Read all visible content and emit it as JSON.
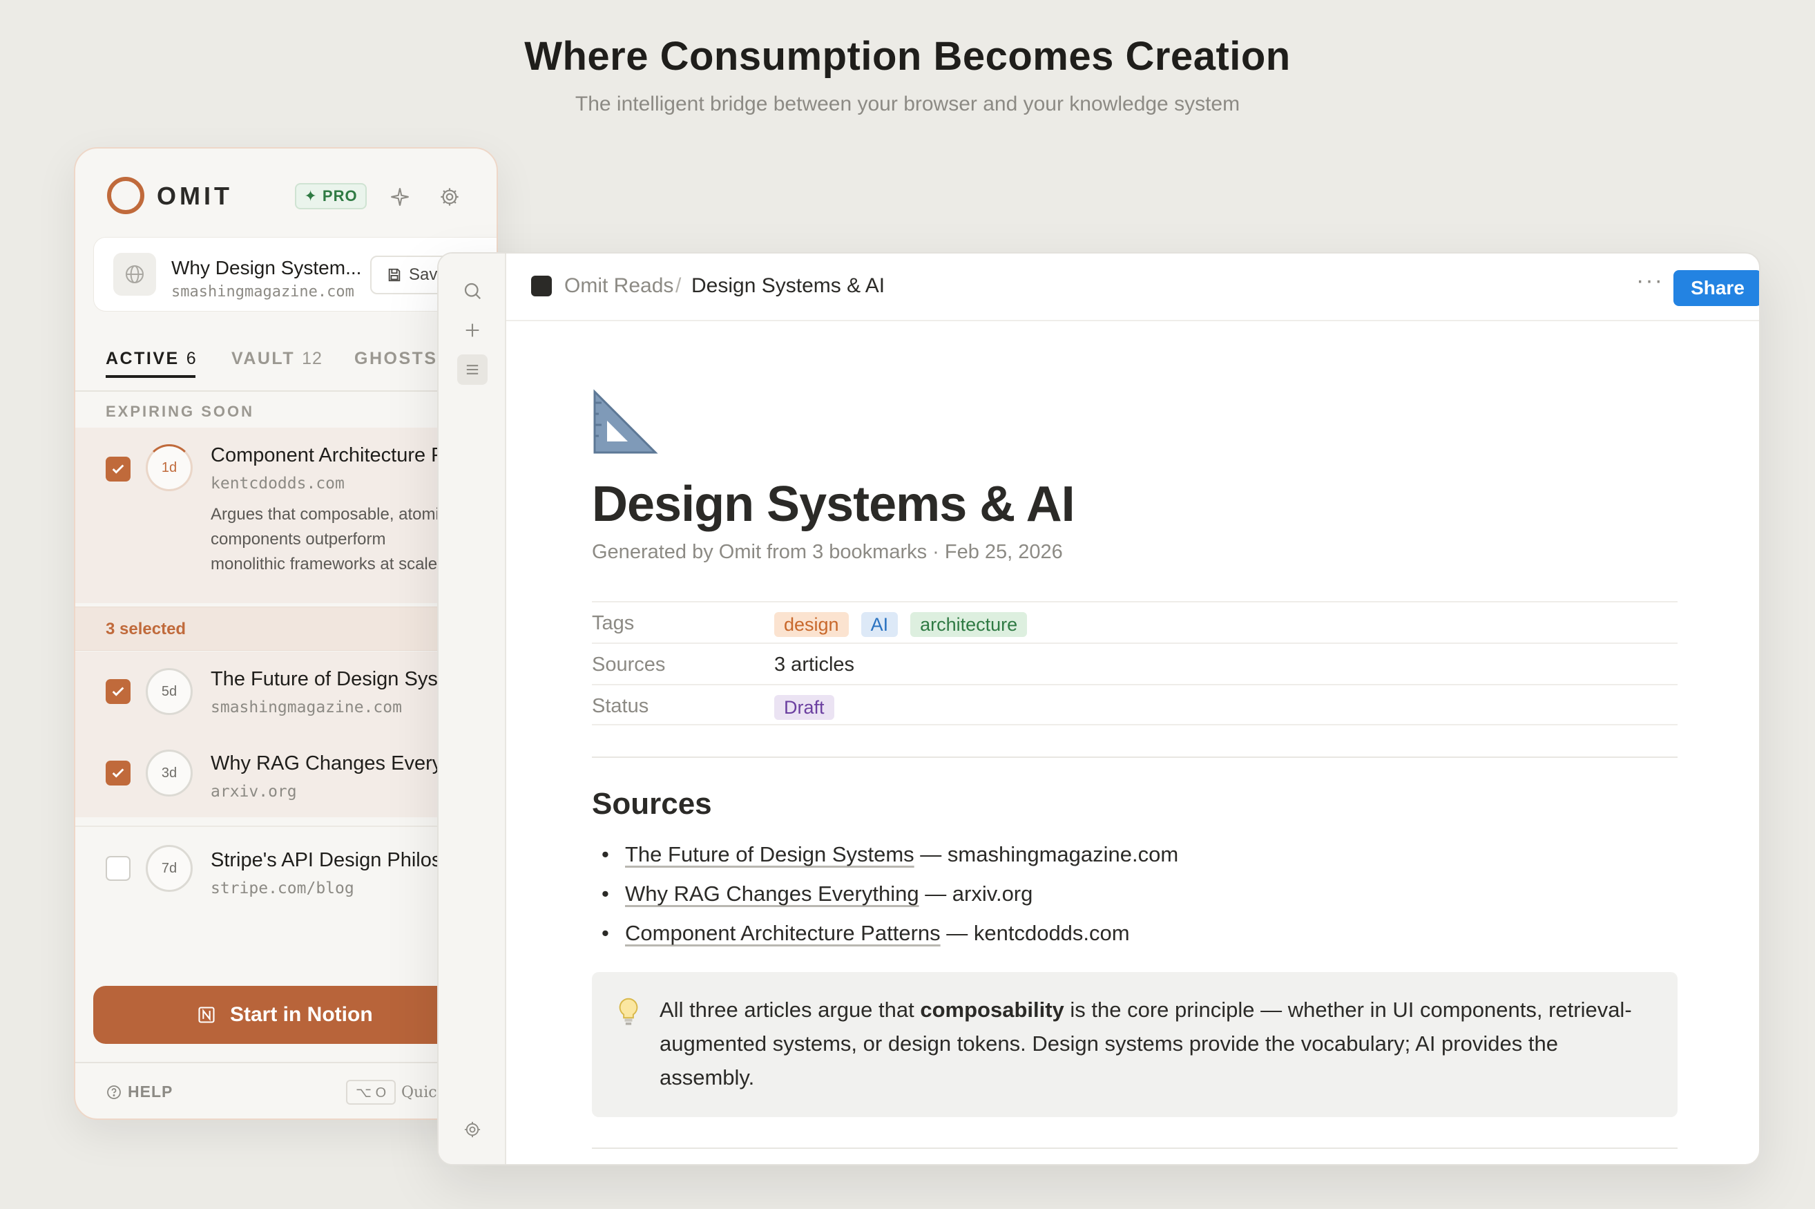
{
  "hero": {
    "title": "Where Consumption Becomes Creation",
    "subtitle": "The intelligent bridge between your browser and your knowledge system"
  },
  "extension": {
    "brand": "OMIT",
    "pro_badge": "✦ PRO",
    "current_page": {
      "title": "Why Design System...",
      "url": "smashingmagazine.com",
      "save_label": "Save"
    },
    "tabs": [
      {
        "label": "ACTIVE",
        "count": "6"
      },
      {
        "label": "VAULT",
        "count": "12"
      },
      {
        "label": "GHOSTS",
        "count": ""
      }
    ],
    "section_label": "EXPIRING SOON",
    "items": [
      {
        "days": "1d",
        "title": "Component Architecture Patterns",
        "url": "kentcdodds.com",
        "desc1": "Argues that composable, atomic",
        "desc2": "components outperform",
        "desc3": "monolithic frameworks at scale",
        "checked": true
      },
      {
        "days": "5d",
        "title": "The Future of Design Systems",
        "url": "smashingmagazine.com",
        "checked": true
      },
      {
        "days": "3d",
        "title": "Why RAG Changes Everything",
        "url": "arxiv.org",
        "checked": true
      },
      {
        "days": "7d",
        "title": "Stripe's API Design Philosophy",
        "url": "stripe.com/blog",
        "checked": false
      }
    ],
    "selected_text": "3 selected",
    "start_button": "Start in Notion",
    "help_label": "HELP",
    "shortcut_key": "⌥ O",
    "quick_label": "Quick"
  },
  "notion": {
    "breadcrumb_parent": "Omit Reads",
    "breadcrumb_sep": "/",
    "breadcrumb_current": "Design Systems & AI",
    "more_label": "···",
    "share_label": "Share",
    "doc": {
      "title": "Design Systems & AI",
      "meta": "Generated by Omit from 3 bookmarks · Feb 25, 2026",
      "props": {
        "tags_key": "Tags",
        "tags": [
          "design",
          "AI",
          "architecture"
        ],
        "sources_key": "Sources",
        "sources_val": "3 articles",
        "status_key": "Status",
        "status_val": "Draft"
      },
      "sources_heading": "Sources",
      "sources": [
        {
          "title": "The Future of Design Systems",
          "domain": " — smashingmagazine.com"
        },
        {
          "title": "Why RAG Changes Everything",
          "domain": " — arxiv.org"
        },
        {
          "title": "Component Architecture Patterns",
          "domain": " — kentcdodds.com"
        }
      ],
      "callout": {
        "pre": "All three articles argue that ",
        "bold": "composability",
        "post": " is the core principle — whether in UI components, retrieval-augmented systems, or design tokens. Design systems provide the vocabulary; AI provides the assembly."
      }
    }
  },
  "colors": {
    "accent": "#c06a3b",
    "share_blue": "#2383e2",
    "tag_design_bg": "#fbe3d0",
    "tag_design_fg": "#c8682b",
    "tag_ai_bg": "#dde9f7",
    "tag_ai_fg": "#2a72c0",
    "tag_arch_bg": "#ddefdf",
    "tag_arch_fg": "#2f7a43",
    "status_bg": "#ebe3f3",
    "status_fg": "#6b3fa0"
  }
}
